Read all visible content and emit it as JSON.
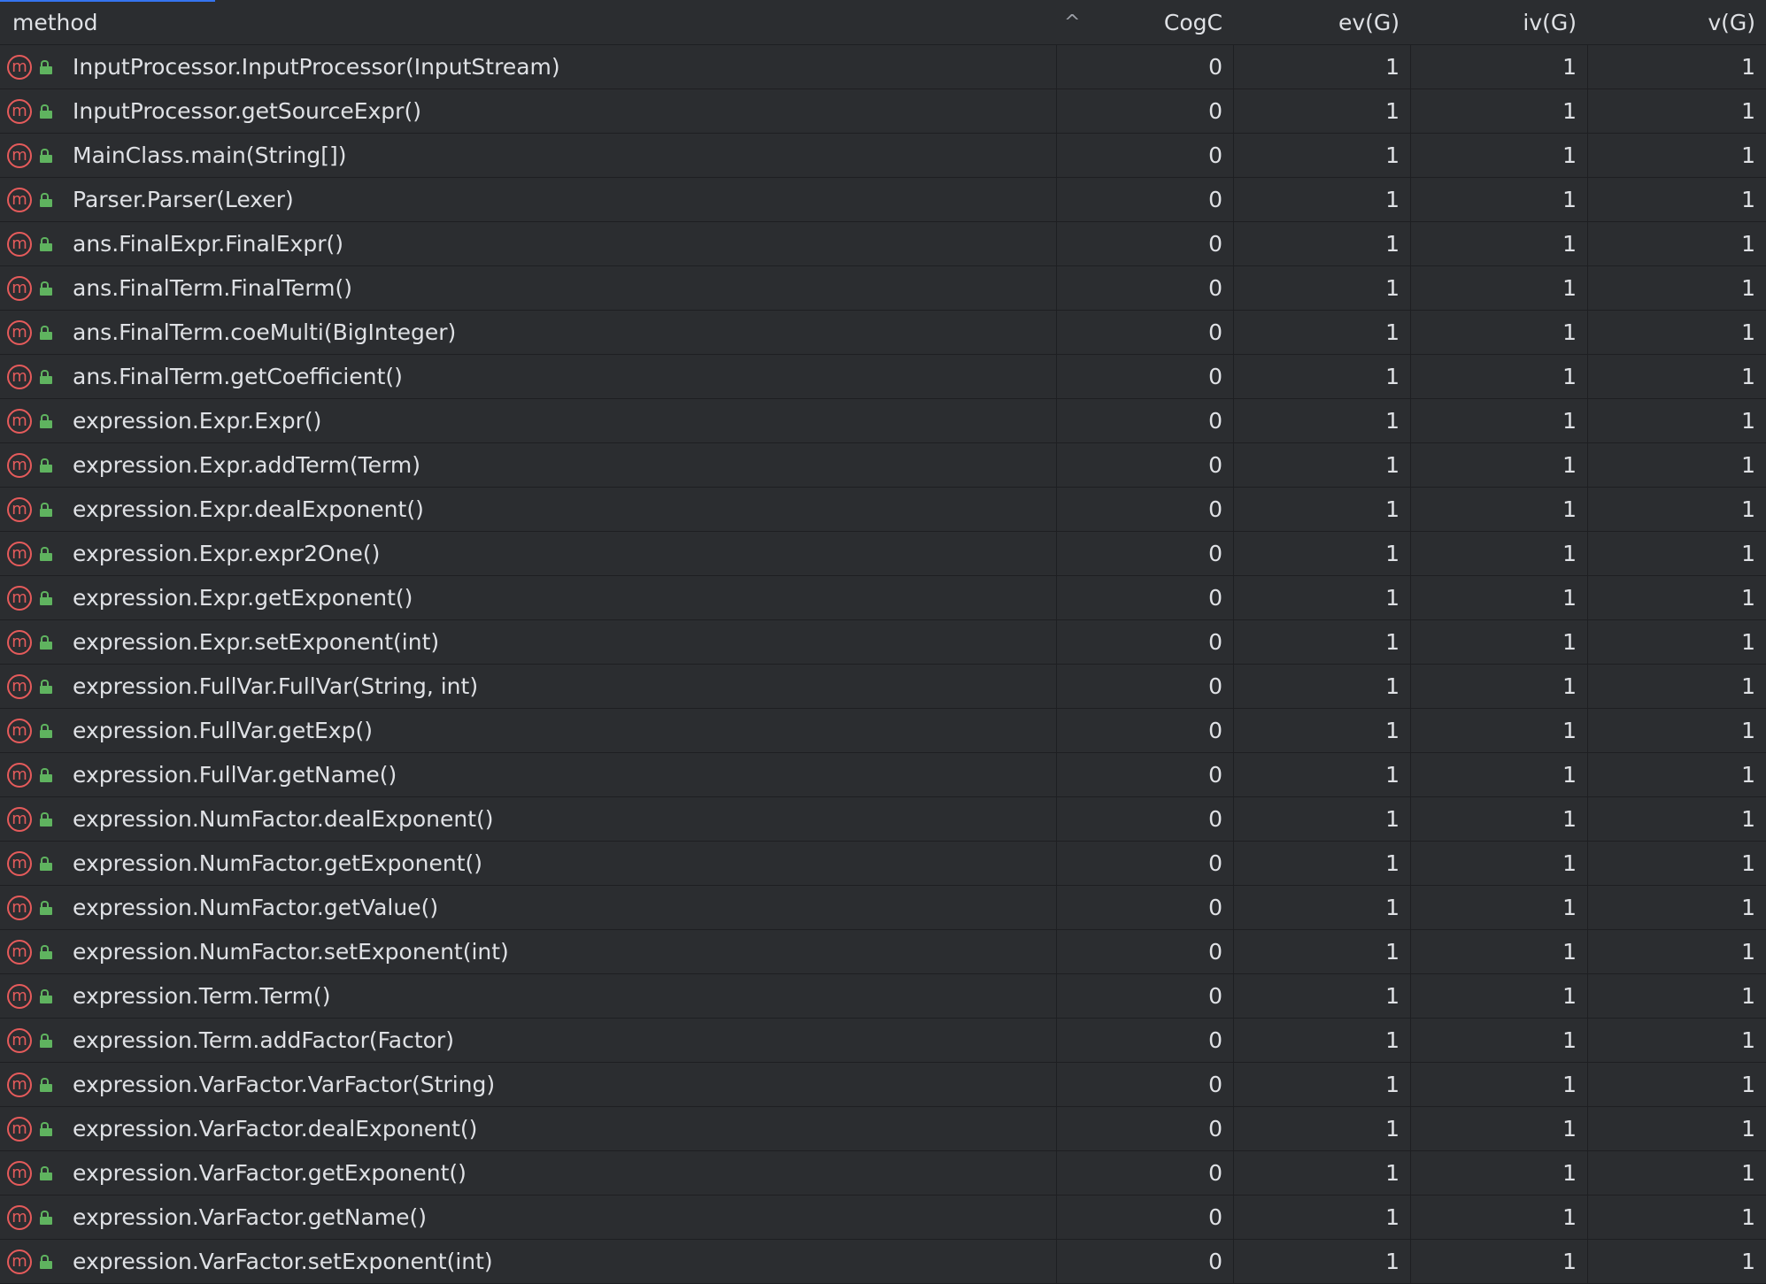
{
  "header": {
    "method": "method",
    "sort_arrow": "^",
    "cogc": "CogC",
    "evg": "ev(G)",
    "ivg": "iv(G)",
    "vg": "v(G)"
  },
  "icons": {
    "method_icon": "method-m-icon",
    "method_icon_glyph": "m",
    "method_icon_color": "#e55b5b",
    "access_icon": "public-lock-icon",
    "access_icon_color": "#5fb35f"
  },
  "rows": [
    {
      "method": "InputProcessor.InputProcessor(InputStream)",
      "cogc": "0",
      "evg": "1",
      "ivg": "1",
      "vg": "1"
    },
    {
      "method": "InputProcessor.getSourceExpr()",
      "cogc": "0",
      "evg": "1",
      "ivg": "1",
      "vg": "1"
    },
    {
      "method": "MainClass.main(String[])",
      "cogc": "0",
      "evg": "1",
      "ivg": "1",
      "vg": "1"
    },
    {
      "method": "Parser.Parser(Lexer)",
      "cogc": "0",
      "evg": "1",
      "ivg": "1",
      "vg": "1"
    },
    {
      "method": "ans.FinalExpr.FinalExpr()",
      "cogc": "0",
      "evg": "1",
      "ivg": "1",
      "vg": "1"
    },
    {
      "method": "ans.FinalTerm.FinalTerm()",
      "cogc": "0",
      "evg": "1",
      "ivg": "1",
      "vg": "1"
    },
    {
      "method": "ans.FinalTerm.coeMulti(BigInteger)",
      "cogc": "0",
      "evg": "1",
      "ivg": "1",
      "vg": "1"
    },
    {
      "method": "ans.FinalTerm.getCoefficient()",
      "cogc": "0",
      "evg": "1",
      "ivg": "1",
      "vg": "1"
    },
    {
      "method": "expression.Expr.Expr()",
      "cogc": "0",
      "evg": "1",
      "ivg": "1",
      "vg": "1"
    },
    {
      "method": "expression.Expr.addTerm(Term)",
      "cogc": "0",
      "evg": "1",
      "ivg": "1",
      "vg": "1"
    },
    {
      "method": "expression.Expr.dealExponent()",
      "cogc": "0",
      "evg": "1",
      "ivg": "1",
      "vg": "1"
    },
    {
      "method": "expression.Expr.expr2One()",
      "cogc": "0",
      "evg": "1",
      "ivg": "1",
      "vg": "1"
    },
    {
      "method": "expression.Expr.getExponent()",
      "cogc": "0",
      "evg": "1",
      "ivg": "1",
      "vg": "1"
    },
    {
      "method": "expression.Expr.setExponent(int)",
      "cogc": "0",
      "evg": "1",
      "ivg": "1",
      "vg": "1"
    },
    {
      "method": "expression.FullVar.FullVar(String, int)",
      "cogc": "0",
      "evg": "1",
      "ivg": "1",
      "vg": "1"
    },
    {
      "method": "expression.FullVar.getExp()",
      "cogc": "0",
      "evg": "1",
      "ivg": "1",
      "vg": "1"
    },
    {
      "method": "expression.FullVar.getName()",
      "cogc": "0",
      "evg": "1",
      "ivg": "1",
      "vg": "1"
    },
    {
      "method": "expression.NumFactor.dealExponent()",
      "cogc": "0",
      "evg": "1",
      "ivg": "1",
      "vg": "1"
    },
    {
      "method": "expression.NumFactor.getExponent()",
      "cogc": "0",
      "evg": "1",
      "ivg": "1",
      "vg": "1"
    },
    {
      "method": "expression.NumFactor.getValue()",
      "cogc": "0",
      "evg": "1",
      "ivg": "1",
      "vg": "1"
    },
    {
      "method": "expression.NumFactor.setExponent(int)",
      "cogc": "0",
      "evg": "1",
      "ivg": "1",
      "vg": "1"
    },
    {
      "method": "expression.Term.Term()",
      "cogc": "0",
      "evg": "1",
      "ivg": "1",
      "vg": "1"
    },
    {
      "method": "expression.Term.addFactor(Factor)",
      "cogc": "0",
      "evg": "1",
      "ivg": "1",
      "vg": "1"
    },
    {
      "method": "expression.VarFactor.VarFactor(String)",
      "cogc": "0",
      "evg": "1",
      "ivg": "1",
      "vg": "1"
    },
    {
      "method": "expression.VarFactor.dealExponent()",
      "cogc": "0",
      "evg": "1",
      "ivg": "1",
      "vg": "1"
    },
    {
      "method": "expression.VarFactor.getExponent()",
      "cogc": "0",
      "evg": "1",
      "ivg": "1",
      "vg": "1"
    },
    {
      "method": "expression.VarFactor.getName()",
      "cogc": "0",
      "evg": "1",
      "ivg": "1",
      "vg": "1"
    },
    {
      "method": "expression.VarFactor.setExponent(int)",
      "cogc": "0",
      "evg": "1",
      "ivg": "1",
      "vg": "1"
    }
  ]
}
